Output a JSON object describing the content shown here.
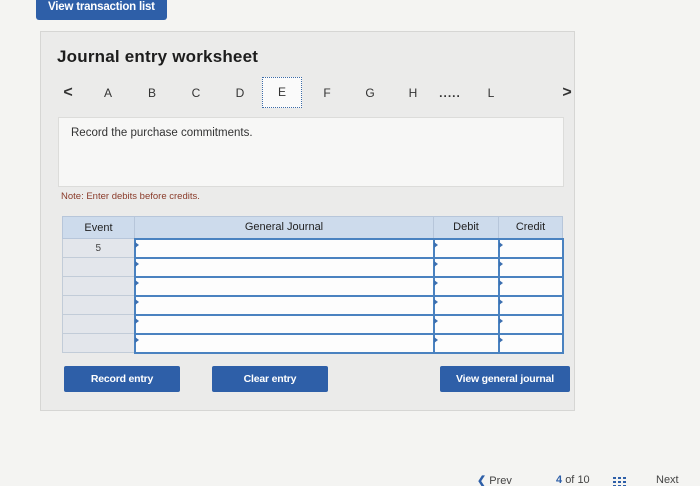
{
  "top_button": {
    "label": "View transaction list"
  },
  "worksheet": {
    "title": "Journal entry worksheet",
    "tabs": {
      "prev": "<",
      "next": ">",
      "letters": [
        "A",
        "B",
        "C",
        "D",
        "E",
        "F",
        "G",
        "H",
        ".....",
        "L"
      ],
      "active": "E"
    },
    "instruction": "Record the purchase commitments.",
    "note": "Note: Enter debits before credits."
  },
  "table": {
    "headers": {
      "event": "Event",
      "journal": "General Journal",
      "debit": "Debit",
      "credit": "Credit"
    },
    "rows": [
      {
        "event": "5",
        "account": "",
        "debit": "",
        "credit": ""
      },
      {
        "event": "",
        "account": "",
        "debit": "",
        "credit": ""
      },
      {
        "event": "",
        "account": "",
        "debit": "",
        "credit": ""
      },
      {
        "event": "",
        "account": "",
        "debit": "",
        "credit": ""
      },
      {
        "event": "",
        "account": "",
        "debit": "",
        "credit": ""
      },
      {
        "event": "",
        "account": "",
        "debit": "",
        "credit": ""
      }
    ]
  },
  "buttons": {
    "record": "Record entry",
    "clear": "Clear entry",
    "view_general": "View general journal"
  },
  "footer": {
    "prev": "Prev",
    "page_current": "4",
    "page_sep": "of",
    "page_total": "10",
    "next": "Next"
  },
  "colors": {
    "accent": "#2e5fa8",
    "header_bg": "#cddbec",
    "input_border": "#4a82c0"
  },
  "icons": {
    "prev": "chevron-left-icon",
    "next": "chevron-right-icon",
    "grid": "grid-icon"
  }
}
